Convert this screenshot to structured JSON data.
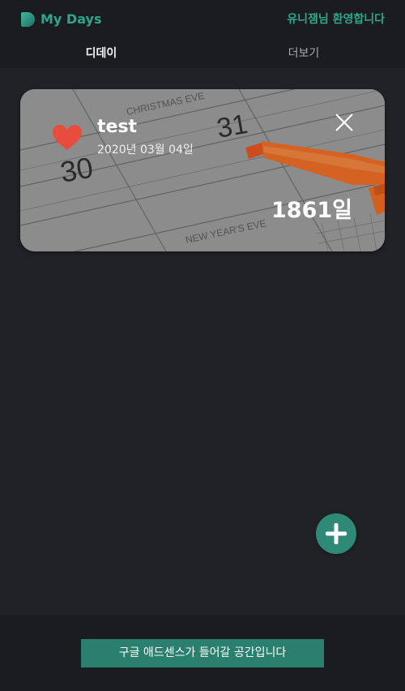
{
  "app": {
    "logo_text": "My Days",
    "welcome_text": "유니잼님 환영합니다"
  },
  "tabs": [
    {
      "label": "디데이",
      "active": true
    },
    {
      "label": "더보기",
      "active": false
    }
  ],
  "dday_cards": [
    {
      "title": "test",
      "date": "2020년 03월 04일",
      "days": "1861일",
      "favorite": true,
      "background_labels": {
        "christmas": "CHRISTMAS EVE",
        "newyear": "NEW YEAR'S EVE",
        "day30": "30",
        "day31": "31"
      }
    }
  ],
  "icons": {
    "favorite": "heart-icon",
    "delete": "close-icon",
    "add": "plus-icon"
  },
  "footer": {
    "ad_text": "구글 애드센스가 들어갈 공간입니다"
  },
  "colors": {
    "accent": "#2fa58c",
    "background": "#212226",
    "header_bg": "#1b1c20",
    "heart": "#e74c3c",
    "fab": "#2e8a77",
    "ad_banner": "#2a7f6e"
  }
}
